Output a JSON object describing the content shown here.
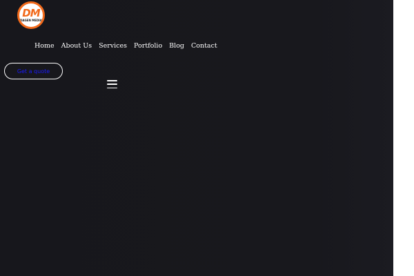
{
  "brand": {
    "logo_mark": "DM",
    "logo_text": "DAGEN MEDIA",
    "accent_color": "#f26a1b"
  },
  "nav": {
    "items": [
      {
        "label": "Home"
      },
      {
        "label": "About Us"
      },
      {
        "label": "Services"
      },
      {
        "label": "Portfolio"
      },
      {
        "label": "Blog"
      },
      {
        "label": "Contact"
      }
    ]
  },
  "cta": {
    "label": "Get a quote"
  },
  "menu_toggle": {
    "icon": "hamburger-icon"
  },
  "colors": {
    "background": "#17171c",
    "nav_text": "#ffffff",
    "cta_text": "#1a1aff",
    "cta_border": "#ffffff"
  }
}
